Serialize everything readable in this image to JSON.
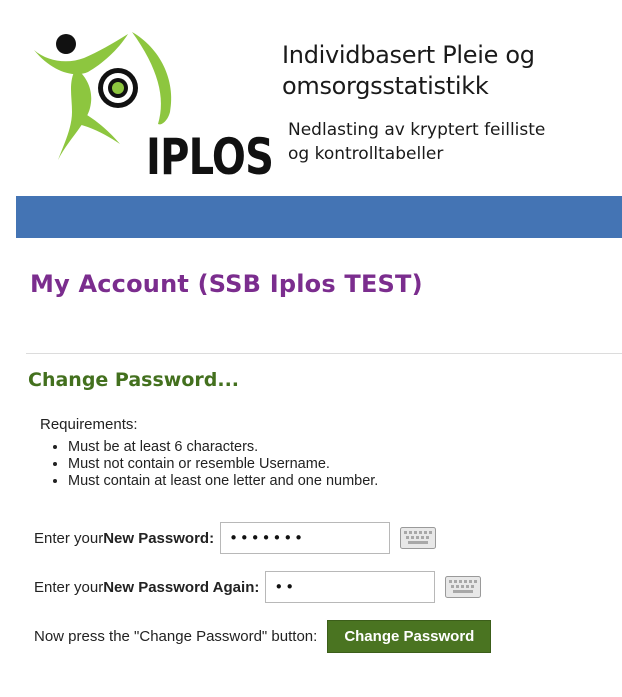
{
  "header": {
    "logo_text": "IPLOS",
    "title_line1": "Individbasert Pleie og",
    "title_line2": "omsorgsstatistikk",
    "subtitle_line1": "Nedlasting av kryptert feilliste",
    "subtitle_line2": "og kontrolltabeller",
    "bar_color": "#4474b4"
  },
  "page": {
    "title": "My Account (SSB Iplos TEST)",
    "section_title": "Change Password..."
  },
  "requirements": {
    "label": "Requirements:",
    "items": [
      "Must be at least 6 characters.",
      "Must not contain or resemble Username.",
      "Must contain at least one letter and one number."
    ]
  },
  "form": {
    "new_password_prefix": "Enter your ",
    "new_password_label": "New Password:",
    "new_password_value": "•••••••",
    "new_password_again_prefix": "Enter your ",
    "new_password_again_label": "New Password Again:",
    "new_password_again_value": "••",
    "keyboard_icon": "keyboard-icon",
    "submit_prompt": "Now press the \"Change Password\" button:",
    "submit_label": "Change Password"
  },
  "colors": {
    "title_purple": "#7b2d8e",
    "section_green": "#43701e",
    "button_green": "#4a7421",
    "logo_green": "#8dc63f"
  }
}
